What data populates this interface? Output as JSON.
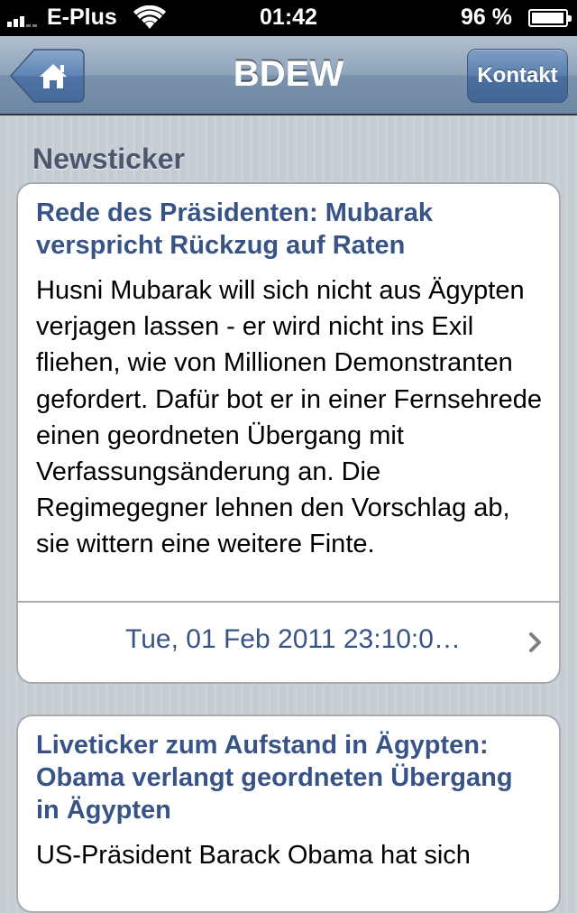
{
  "status_bar": {
    "carrier": "E-Plus",
    "time": "01:42",
    "battery_percent": "96 %",
    "battery_level": 0.96,
    "signal_bars": 3
  },
  "nav": {
    "title": "BDEW",
    "home_icon": "home-icon",
    "contact_label": "Kontakt"
  },
  "section": {
    "header": "Newsticker"
  },
  "news": [
    {
      "title": "Rede des Präsidenten: Mubarak verspricht Rückzug auf Raten",
      "body": "Husni Mubarak will sich nicht aus Ägypten verjagen lassen - er wird nicht ins Exil fliehen, wie von Millionen Demonstranten gefordert. Dafür bot er in einer Fernsehrede einen geordneten Übergang mit Verfassungsänderung an. Die Regimegegner lehnen den Vorschlag ab, sie wittern eine weitere Finte.",
      "date": "Tue, 01 Feb 2011 23:10:0…"
    },
    {
      "title": "Liveticker zum Aufstand in Ägypten: Obama verlangt geordneten Übergang in Ägypten",
      "body": "US-Präsident Barack Obama hat sich"
    }
  ],
  "colors": {
    "link_blue": "#385487",
    "navbar": "#6d87a4",
    "background": "#c5ccd4"
  }
}
